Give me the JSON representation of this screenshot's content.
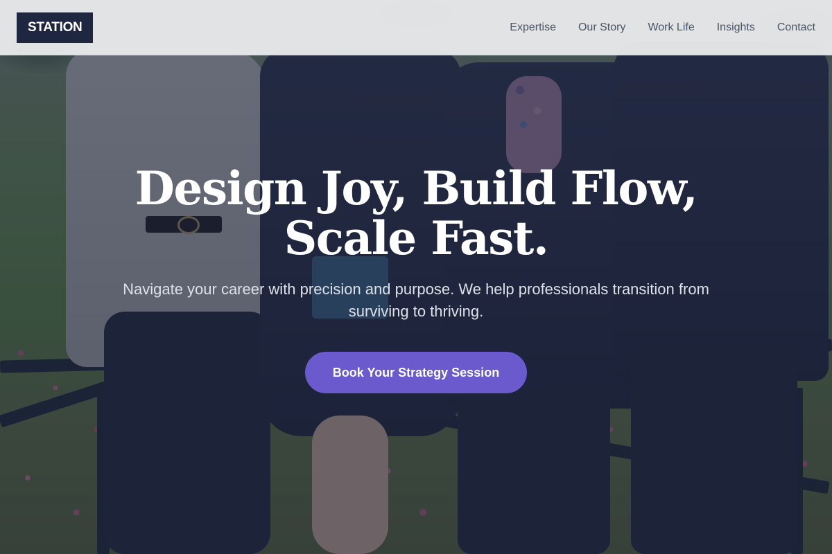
{
  "header": {
    "logo_text": "STATION",
    "nav": [
      "Expertise",
      "Our Story",
      "Work Life",
      "Insights",
      "Contact"
    ]
  },
  "hero": {
    "headline": "Design Joy, Build Flow, Scale Fast.",
    "subheadline": "Navigate your career with precision and purpose. We help professionals transition from surviving to thriving.",
    "cta_label": "Book Your Strategy Session"
  },
  "colors": {
    "header_bg": "#e8e9ea",
    "logo_bg": "#1f2740",
    "nav_text": "#4a5568",
    "overlay": "rgba(28,35,58,0.60)",
    "cta_bg": "#6a5acd",
    "headline": "#ffffff"
  }
}
